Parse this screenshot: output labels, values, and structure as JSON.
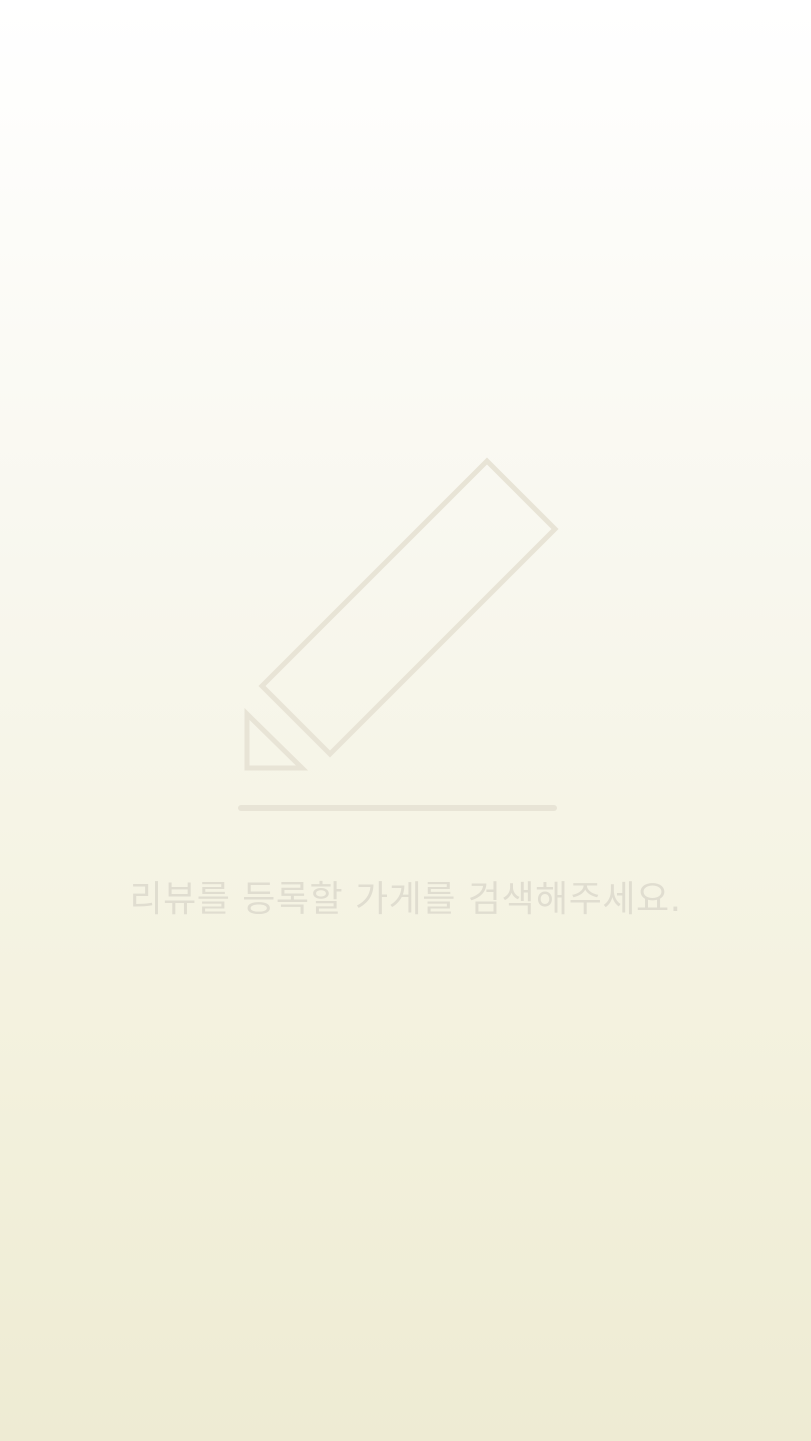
{
  "empty_state": {
    "icon": "pencil-icon",
    "message": "리뷰를 등록할 가게를 검색해주세요.",
    "icon_color": "#e8e4d6",
    "text_color": "#e0ddd0"
  },
  "colors": {
    "background_top": "#ffffff",
    "background_bottom": "#eeebd3"
  }
}
